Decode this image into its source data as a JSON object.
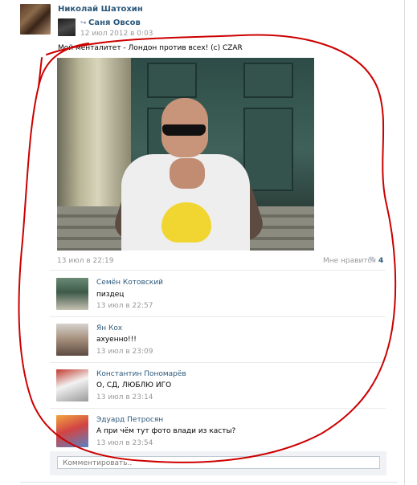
{
  "post": {
    "author": "Николай Шатохин",
    "repost_author": "Саня Овсов",
    "repost_date": "12 июл 2012 в 0:03",
    "text": "Мой менталитет - Лондон против всех! (с) CZAR",
    "date": "13 июл в 22:19",
    "like_label": "Мне нравится",
    "like_count": "4"
  },
  "comments": [
    {
      "name": "Семён Котовский",
      "text": "пиздец",
      "date": "13 июл в 22:57"
    },
    {
      "name": "Ян Кох",
      "text": "ахуенно!!!",
      "date": "13 июл в 23:09"
    },
    {
      "name": "Константин Пономарёв",
      "text": "О, СД, ЛЮБЛЮ ИГО",
      "date": "13 июл в 23:14"
    },
    {
      "name": "Эдуард Петросян",
      "text": "А при чём тут фото влади из касты?",
      "date": "13 июл в 23:54"
    }
  ],
  "comment_input": {
    "placeholder": "Комментировать.."
  },
  "annotation": {
    "color": "#cc0000"
  }
}
